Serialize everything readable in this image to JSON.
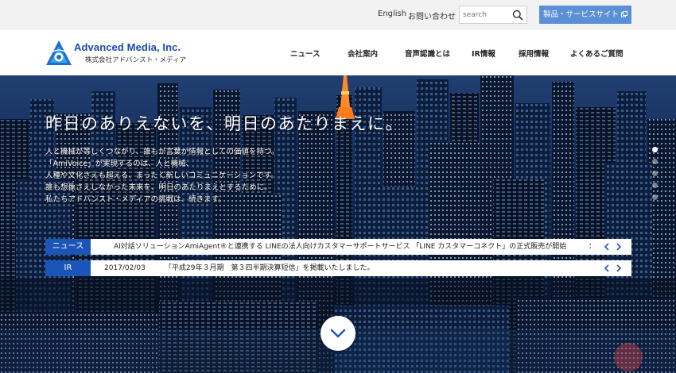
{
  "utility_bar": {
    "english_label": "English",
    "contact_label": "お問い合わせ",
    "search_placeholder": "search",
    "product_button_label": "製品・サービスサイト",
    "product_button_color": "#5b8fd6"
  },
  "logo": {
    "english_name": "Advanced Media, Inc.",
    "japanese_name": "株式会社アドバンスト・メディア",
    "brand_color": "#1a4aa6"
  },
  "nav": {
    "items": [
      {
        "label": "ニュース"
      },
      {
        "label": "会社案内"
      },
      {
        "label": "音声認識とは"
      },
      {
        "label": "IR情報"
      },
      {
        "label": "採用情報"
      },
      {
        "label": "よくあるご質問"
      }
    ]
  },
  "hero": {
    "headline": "昨日のありえないを、明日のあたりまえに。",
    "body_lines": [
      "人と機械が等しくつながり、誰もが言葉が情報としての価値を持つ。",
      "「AmiVoice」が実現するのは、人と機械、",
      "人種や文化さえも超える、まったく新しいコミュニケーションです。",
      "誰も想像さえしなかった未来を、明日のあたりまえとするために。",
      "私たちアドバンスト・メディアの挑戦は、続きます。"
    ]
  },
  "news_ticker": {
    "tag": "ニュース",
    "text": "AI対話ソリューションAmiAgent®と連携する LINEの法人向けカスタマーサポートサービス 「LINE カスタマーコネクト」の正式販売が開始",
    "trailing_mark": "：",
    "tag_color": "#1b55b8"
  },
  "ir_ticker": {
    "tag": "IR",
    "date": "2017/02/03",
    "text": "「平成29年３月期　第３四半期決算短信」を掲載いたしました。",
    "tag_color": "#1b55b8"
  },
  "icons": {
    "search": "search-icon",
    "external": "external-link-icon",
    "prev": "chevron-left-icon",
    "next": "chevron-right-icon",
    "scroll": "chevron-down-icon"
  }
}
